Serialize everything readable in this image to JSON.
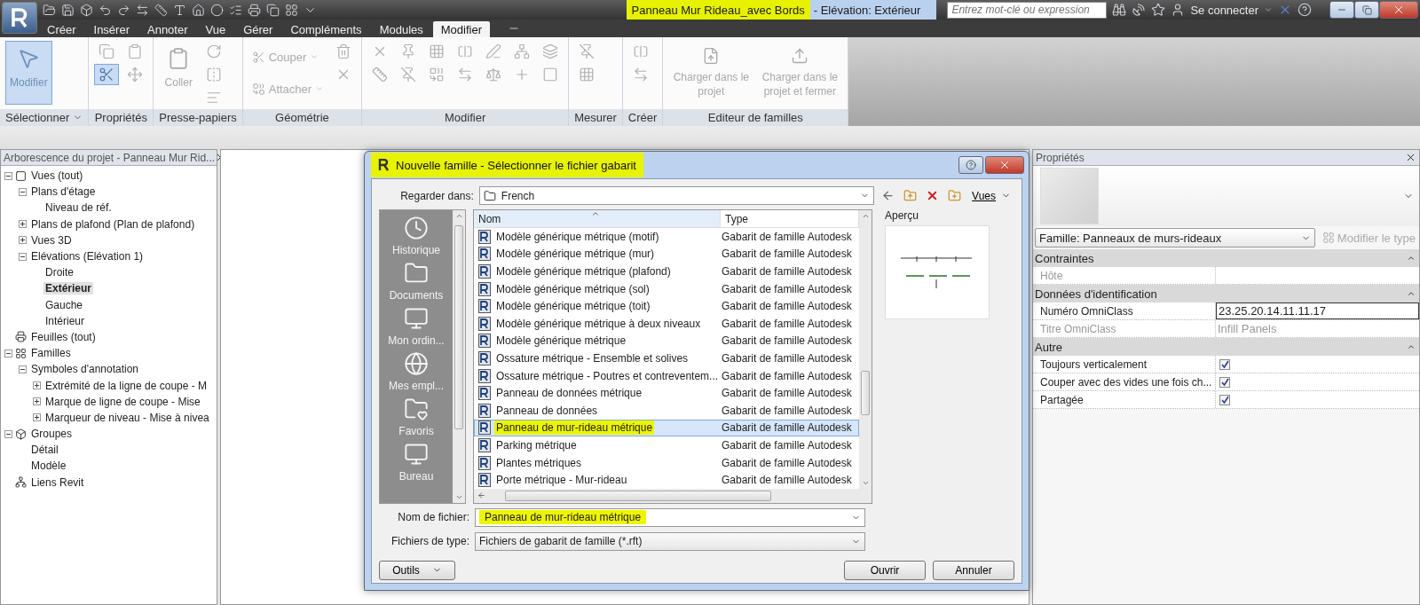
{
  "title_bar": {
    "title_highlighted": "Panneau Mur Rideau_avec Bords",
    "title_rest": "- Elévation: Extérieur",
    "search": {
      "placeholder": "Entrez mot-clé ou expression"
    },
    "sign_in": "Se connecter"
  },
  "tabs": [
    {
      "label": "Créer",
      "selected": false
    },
    {
      "label": "Insérer",
      "selected": false
    },
    {
      "label": "Annoter",
      "selected": false
    },
    {
      "label": "Vue",
      "selected": false
    },
    {
      "label": "Gérer",
      "selected": false
    },
    {
      "label": "Compléments",
      "selected": false
    },
    {
      "label": "Modules",
      "selected": false
    },
    {
      "label": "Modifier",
      "selected": true
    }
  ],
  "ribbon": {
    "panels": [
      {
        "label": "Sélectionner",
        "dropdown": true,
        "tools": [
          {
            "kind": "large",
            "label": "Modifier",
            "selected": true
          }
        ]
      },
      {
        "label": "Propriétés",
        "dropdown": false,
        "tools": [
          {
            "kind": "icon",
            "selected": false
          },
          {
            "kind": "icon",
            "selected": true
          },
          {
            "kind": "icon",
            "selected": false
          },
          {
            "kind": "icon",
            "selected": false
          }
        ]
      },
      {
        "label": "Presse-papiers",
        "dropdown": false,
        "tools": [
          {
            "kind": "large",
            "label": "Coller",
            "selected": false
          },
          {
            "kind": "icon",
            "selected": false
          },
          {
            "kind": "icon",
            "selected": false
          },
          {
            "kind": "icon",
            "selected": false
          }
        ]
      },
      {
        "label": "Géométrie",
        "dropdown": false,
        "tools": [
          {
            "kind": "small",
            "label": "Couper"
          },
          {
            "kind": "small",
            "label": "Attacher"
          },
          {
            "kind": "icon",
            "selected": false
          },
          {
            "kind": "icon",
            "selected": false
          }
        ]
      },
      {
        "label": "Modifier",
        "dropdown": false,
        "tools": [
          {
            "kind": "icon",
            "selected": false
          },
          {
            "kind": "icon",
            "selected": false
          },
          {
            "kind": "icon",
            "selected": false
          },
          {
            "kind": "icon",
            "selected": false
          },
          {
            "kind": "icon",
            "selected": false
          },
          {
            "kind": "icon",
            "selected": false
          },
          {
            "kind": "icon",
            "selected": false
          },
          {
            "kind": "icon",
            "selected": false
          },
          {
            "kind": "icon",
            "selected": false
          },
          {
            "kind": "icon",
            "selected": false
          },
          {
            "kind": "icon",
            "selected": false
          },
          {
            "kind": "icon",
            "selected": false
          },
          {
            "kind": "icon",
            "selected": false
          },
          {
            "kind": "icon",
            "selected": false
          }
        ]
      },
      {
        "label": "Mesurer",
        "dropdown": false,
        "tools": [
          {
            "kind": "icon",
            "selected": false
          },
          {
            "kind": "icon",
            "selected": false
          }
        ]
      },
      {
        "label": "Créer",
        "dropdown": false,
        "tools": [
          {
            "kind": "icon",
            "selected": false
          },
          {
            "kind": "icon",
            "selected": false
          }
        ]
      },
      {
        "label": "Editeur de familles",
        "dropdown": false,
        "tools": [
          {
            "kind": "large",
            "label": "Charger dans le projet",
            "selected": false
          },
          {
            "kind": "large",
            "label": "Charger dans le projet et fermer",
            "selected": false
          }
        ]
      }
    ]
  },
  "project_browser": {
    "title": "Arborescence du projet - Panneau Mur Rid...",
    "items": [
      {
        "label": "Vues (tout)",
        "expanded": true,
        "selected": false,
        "children": [
          {
            "label": "Plans d'étage",
            "expanded": true,
            "selected": false,
            "children": [
              {
                "label": "Niveau de réf.",
                "selected": false
              }
            ]
          },
          {
            "label": "Plans de plafond (Plan de plafond)",
            "expanded": false,
            "selected": false
          },
          {
            "label": "Vues 3D",
            "expanded": false,
            "selected": false
          },
          {
            "label": "Elévations (Elévation 1)",
            "expanded": true,
            "selected": false,
            "children": [
              {
                "label": "Droite",
                "selected": false
              },
              {
                "label": "Extérieur",
                "selected": true
              },
              {
                "label": "Gauche",
                "selected": false
              },
              {
                "label": "Intérieur",
                "selected": false
              }
            ]
          }
        ]
      },
      {
        "label": "Feuilles (tout)",
        "selected": false
      },
      {
        "label": "Familles",
        "expanded": true,
        "selected": false,
        "children": [
          {
            "label": "Symboles d'annotation",
            "expanded": true,
            "selected": false,
            "children": [
              {
                "label": "Extrémité de la ligne de coupe - M",
                "expanded": false,
                "selected": false
              },
              {
                "label": "Marque de ligne de coupe - Mise",
                "expanded": false,
                "selected": false
              },
              {
                "label": "Marqueur de niveau - Mise à nivea",
                "expanded": false,
                "selected": false
              }
            ]
          }
        ]
      },
      {
        "label": "Groupes",
        "expanded": true,
        "selected": false,
        "children": [
          {
            "label": "Détail",
            "selected": false
          },
          {
            "label": "Modèle",
            "selected": false
          }
        ]
      },
      {
        "label": "Liens Revit",
        "selected": false
      }
    ]
  },
  "dialog": {
    "title": "Nouvelle famille - Sélectionner le fichier gabarit",
    "look_in_label": "Regarder dans:",
    "look_in_value": "French",
    "views_menu": "Vues",
    "places": [
      {
        "label": "Historique"
      },
      {
        "label": "Documents"
      },
      {
        "label": "Mon ordin..."
      },
      {
        "label": "Mes empl..."
      },
      {
        "label": "Favoris"
      },
      {
        "label": "Bureau"
      }
    ],
    "columns": [
      "Nom",
      "Type"
    ],
    "files": [
      {
        "name": "Modèle générique métrique (motif)",
        "type": "Gabarit de famille Autodesk",
        "selected": false
      },
      {
        "name": "Modèle générique métrique (mur)",
        "type": "Gabarit de famille Autodesk",
        "selected": false
      },
      {
        "name": "Modèle générique métrique (plafond)",
        "type": "Gabarit de famille Autodesk",
        "selected": false
      },
      {
        "name": "Modèle générique métrique (sol)",
        "type": "Gabarit de famille Autodesk",
        "selected": false
      },
      {
        "name": "Modèle générique métrique (toit)",
        "type": "Gabarit de famille Autodesk",
        "selected": false
      },
      {
        "name": "Modèle générique métrique à deux niveaux",
        "type": "Gabarit de famille Autodesk",
        "selected": false
      },
      {
        "name": "Modèle générique métrique",
        "type": "Gabarit de famille Autodesk",
        "selected": false
      },
      {
        "name": "Ossature métrique - Ensemble et solives",
        "type": "Gabarit de famille Autodesk",
        "selected": false
      },
      {
        "name": "Ossature métrique - Poutres et contreventem...",
        "type": "Gabarit de famille Autodesk",
        "selected": false
      },
      {
        "name": "Panneau de données métrique",
        "type": "Gabarit de famille Autodesk",
        "selected": false
      },
      {
        "name": "Panneau de données",
        "type": "Gabarit de famille Autodesk",
        "selected": false
      },
      {
        "name": "Panneau de mur-rideau métrique",
        "type": "Gabarit de famille Autodesk",
        "selected": true
      },
      {
        "name": "Parking métrique",
        "type": "Gabarit de famille Autodesk",
        "selected": false
      },
      {
        "name": "Plantes métriques",
        "type": "Gabarit de famille Autodesk",
        "selected": false
      },
      {
        "name": "Porte métrique - Mur-rideau",
        "type": "Gabarit de famille Autodesk",
        "selected": false
      }
    ],
    "preview_label": "Aperçu",
    "file_name_label": "Nom de fichier:",
    "file_name_value": "Panneau de mur-rideau métrique",
    "file_type_label": "Fichiers de type:",
    "file_type_value": "Fichiers de gabarit de famille  (*.rft)",
    "buttons": [
      {
        "label": "Outils",
        "kind": "menu"
      },
      {
        "label": "Ouvrir",
        "kind": "push"
      },
      {
        "label": "Annuler",
        "kind": "push"
      }
    ]
  },
  "properties": {
    "title": "Propriétés",
    "type_selector": "Famille: Panneaux de murs-rideaux",
    "edit_type": "Modifier le type",
    "groups": [
      {
        "label": "Contraintes",
        "expanded": true,
        "rows": [
          {
            "label": "Hôte",
            "kind": "text",
            "disabled": true
          }
        ]
      },
      {
        "label": "Données d'identification",
        "expanded": true,
        "rows": [
          {
            "label": "Numéro OmniClass",
            "kind": "field",
            "value": "23.25.20.14.11.11.17",
            "disabled": false
          },
          {
            "label": "Titre OmniClass",
            "kind": "text",
            "value": "Infill Panels",
            "disabled": true
          }
        ]
      },
      {
        "label": "Autre",
        "expanded": true,
        "rows": [
          {
            "label": "Toujours verticalement",
            "kind": "checkbox",
            "checked": true,
            "disabled": false
          },
          {
            "label": "Couper avec des vides une fois ch...",
            "kind": "checkbox",
            "checked": true,
            "disabled": false
          },
          {
            "label": "Partagée",
            "kind": "checkbox",
            "checked": true,
            "disabled": false
          }
        ]
      }
    ]
  }
}
